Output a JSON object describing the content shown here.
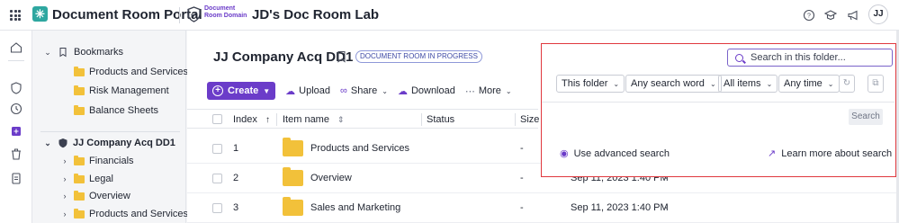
{
  "topbar": {
    "app_title": "Document Room Portal",
    "domain_label_line1": "Document",
    "domain_label_line2": "Room Domain",
    "lab_title": "JD's Doc Room Lab",
    "avatar_initials": "JJ"
  },
  "tree": {
    "bookmarks_label": "Bookmarks",
    "bookmarks": [
      "Products and Services",
      "Risk Management",
      "Balance Sheets"
    ],
    "room_label": "JJ Company Acq DD1",
    "room_folders": [
      "Financials",
      "Legal",
      "Overview",
      "Products and Services"
    ]
  },
  "main": {
    "room_title": "JJ Company Acq DD1",
    "status_badge": "DOCUMENT ROOM IN PROGRESS",
    "toolbar": {
      "create": "Create",
      "upload": "Upload",
      "share": "Share",
      "download": "Download",
      "more": "More"
    },
    "columns": {
      "index": "Index",
      "item_name": "Item name",
      "status": "Status",
      "size": "Size"
    },
    "rows": [
      {
        "index": "1",
        "name": "Products and Services",
        "status": "-",
        "date": "",
        "extra": ""
      },
      {
        "index": "2",
        "name": "Overview",
        "status": "-",
        "date": "Sep 11, 2023 1:40 PM",
        "extra": "-"
      },
      {
        "index": "3",
        "name": "Sales and Marketing",
        "status": "-",
        "date": "Sep 11, 2023 1:40 PM",
        "extra": "-"
      }
    ]
  },
  "search_panel": {
    "placeholder": "Search in this folder...",
    "scope": "This folder",
    "word_mode": "Any search word",
    "items": "All items",
    "time": "Any time",
    "search_button": "Search",
    "advanced": "Use advanced search",
    "learn_more": "Learn more about search"
  },
  "colors": {
    "brand": "#6b3cc9",
    "logo": "#2ea7a0",
    "highlight": "#e0383e",
    "folder": "#f2c13a"
  }
}
